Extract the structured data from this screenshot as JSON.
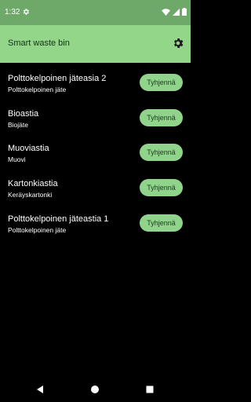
{
  "status_bar": {
    "time": "1:32",
    "icons": [
      "settings-icon",
      "wifi-icon",
      "signal-icon",
      "battery-icon"
    ]
  },
  "app_bar": {
    "title": "Smart waste bin",
    "settings_icon": "gear-icon"
  },
  "bins": [
    {
      "name": "Polttokelpoinen jäteasia 2",
      "type": "Polttokelpoinen jäte",
      "button": "Tyhjennä"
    },
    {
      "name": "Bioastia",
      "type": "Biojäte",
      "button": "Tyhjennä"
    },
    {
      "name": "Muoviastia",
      "type": "Muovi",
      "button": "Tyhjennä"
    },
    {
      "name": "Kartonkiastia",
      "type": "Keräyskartonki",
      "button": "Tyhjennä"
    },
    {
      "name": "Polttokelpoinen jäteastia 1",
      "type": "Polttokelpoinen jäte",
      "button": "Tyhjennä"
    }
  ],
  "nav_bar": {
    "buttons": [
      "back-icon",
      "home-icon",
      "recents-icon"
    ]
  },
  "colors": {
    "status_bar": "#6fa96a",
    "app_bar": "#93d589",
    "button": "#8fd48a",
    "background": "#000000"
  }
}
